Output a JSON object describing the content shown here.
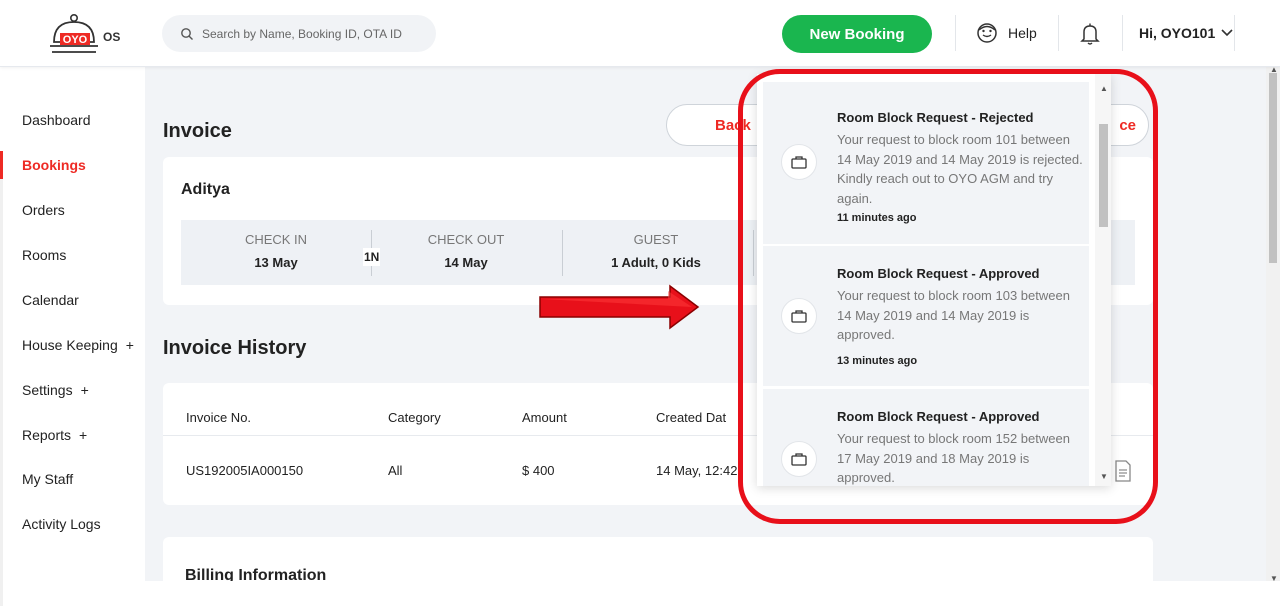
{
  "header": {
    "logo_text": "OYO",
    "logo_suffix": "OS",
    "search_placeholder": "Search by Name, Booking ID, OTA ID",
    "new_booking_label": "New Booking",
    "help_label": "Help",
    "user_greeting": "Hi, OYO101"
  },
  "sidebar": {
    "items": [
      {
        "label": "Dashboard",
        "plus": ""
      },
      {
        "label": "Bookings",
        "plus": ""
      },
      {
        "label": "Orders",
        "plus": ""
      },
      {
        "label": "Rooms",
        "plus": ""
      },
      {
        "label": "Calendar",
        "plus": ""
      },
      {
        "label": "House Keeping",
        "plus": "+"
      },
      {
        "label": "Settings",
        "plus": "+"
      },
      {
        "label": "Reports",
        "plus": "+"
      },
      {
        "label": "My Staff",
        "plus": ""
      },
      {
        "label": "Activity Logs",
        "plus": ""
      }
    ]
  },
  "invoice": {
    "title": "Invoice",
    "back_label": "Back",
    "right_button_label": "ce",
    "guest_name": "Aditya",
    "check_in_label": "CHECK IN",
    "check_in_value": "13 May",
    "nights": "1N",
    "check_out_label": "CHECK OUT",
    "check_out_value": "14 May",
    "guest_label": "GUEST",
    "guest_value": "1 Adult, 0 Kids"
  },
  "history": {
    "title": "Invoice History",
    "columns": [
      "Invoice No.",
      "Category",
      "Amount",
      "Created Dat"
    ],
    "rows": [
      {
        "invoice_no": "US192005IA000150",
        "category": "All",
        "amount": "$ 400",
        "created": "14 May, 12:42"
      }
    ]
  },
  "billing": {
    "title": "Billing Information"
  },
  "notifications": [
    {
      "title": "Room Block Request - Rejected",
      "body": "Your request to block room 101 between 14 May 2019 and 14 May 2019 is rejected. Kindly reach out to OYO AGM and try again.",
      "time": "11 minutes ago"
    },
    {
      "title": "Room Block Request - Approved",
      "body": "Your request to block room 103 between 14 May 2019 and 14 May 2019 is approved.",
      "time": "13 minutes ago"
    },
    {
      "title": "Room Block Request - Approved",
      "body": "Your request to block room 152 between 17 May 2019 and 18 May 2019 is approved.",
      "time": ""
    }
  ],
  "colors": {
    "brand_red": "#ee2a24",
    "new_booking_green": "#1ab64f",
    "annotation_red": "#e8101a",
    "page_bg": "#f2f4f7"
  }
}
